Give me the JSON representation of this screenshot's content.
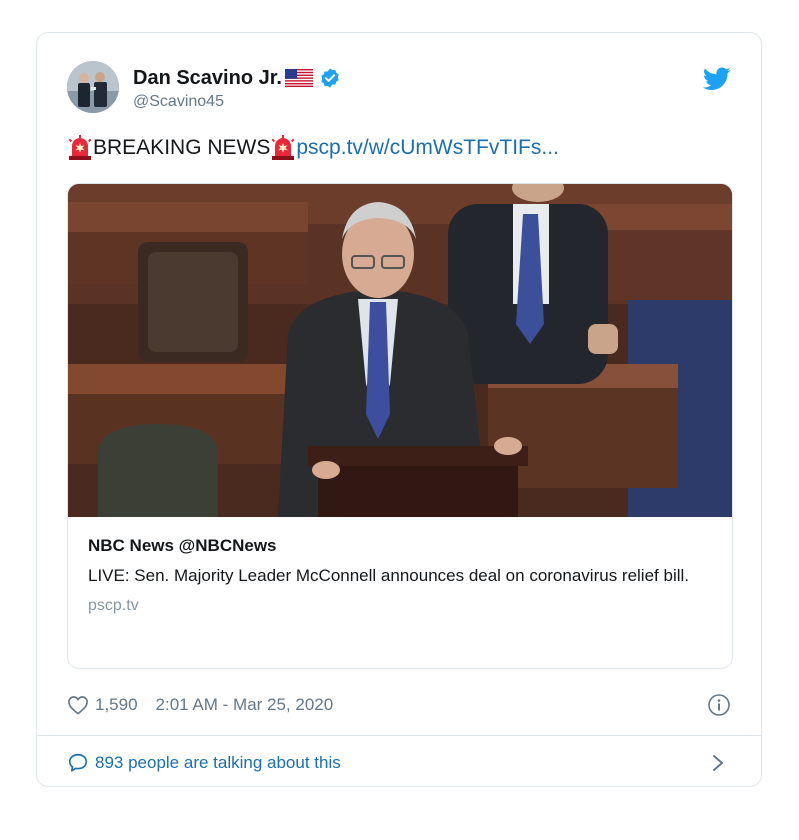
{
  "tweet": {
    "display_name": "Dan Scavino Jr.",
    "handle": "@Scavino45",
    "text_prefix": "BREAKING NEWS",
    "link_text": "pscp.tv/w/cUmWsTFvTIFs...",
    "icons": {
      "avatar": "avatar-photo",
      "flag": "us-flag-icon",
      "verified": "verified-badge-icon",
      "brand": "twitter-bird-icon",
      "emoji": "police-siren-icon"
    },
    "colors": {
      "link": "#1b6faf",
      "brand": "#1da1f2",
      "secondary": "#657786",
      "border": "#e1e8ed"
    }
  },
  "card": {
    "author": "NBC News @NBCNews",
    "description": "LIVE: Sen. Majority Leader McConnell announces deal on coronavirus relief bill.",
    "domain": "pscp.tv"
  },
  "meta": {
    "likes": "1,590",
    "timestamp": "2:01 AM - Mar 25, 2020"
  },
  "footer": {
    "talking": "893 people are talking about this"
  }
}
